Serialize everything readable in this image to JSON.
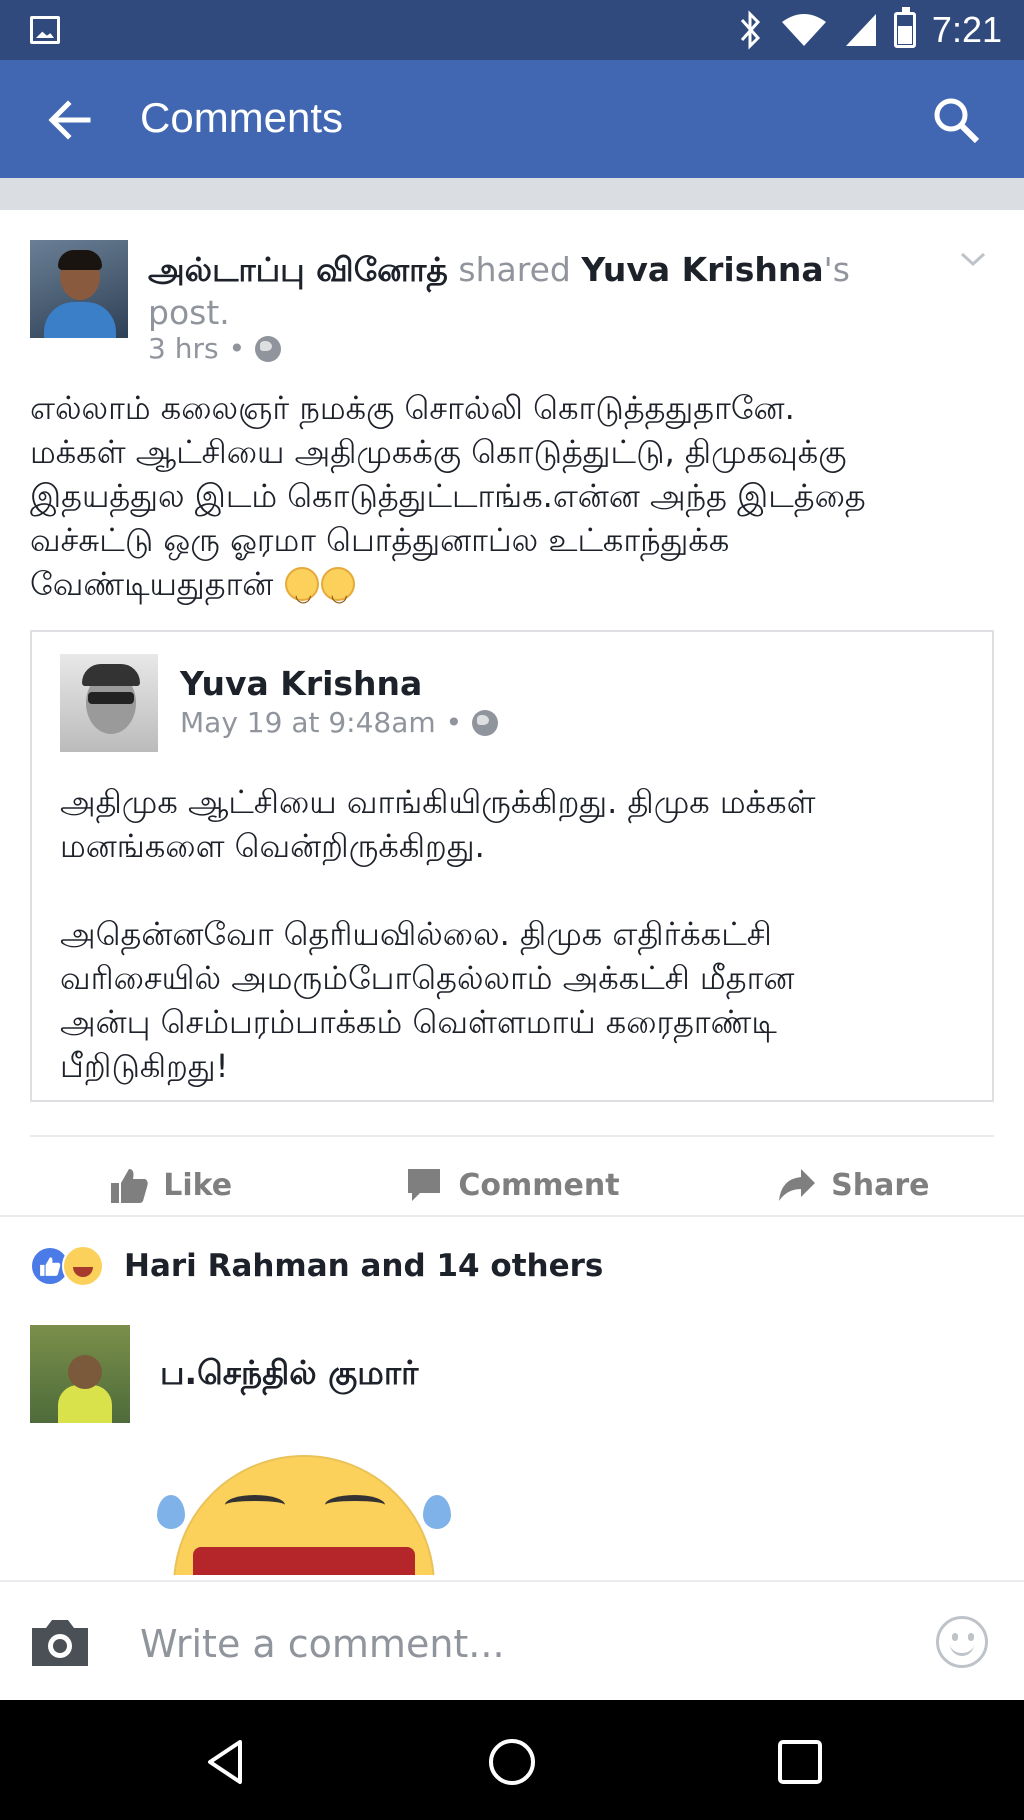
{
  "status_bar": {
    "time": "7:21"
  },
  "app_bar": {
    "title": "Comments"
  },
  "post": {
    "author": "அல்டாப்பு வினோத்",
    "shared_word": "shared",
    "shared_from": "Yuva Krishna",
    "shared_suffix": "'s",
    "post_word": "post.",
    "time": "3 hrs",
    "body": "எல்லாம் கலைஞர் நமக்கு சொல்லி கொடுத்ததுதானே.\nமக்கள் ஆட்சியை அதிமுகக்கு கொடுத்துட்டு, திமுகவுக்கு\nஇதயத்துல இடம் கொடுத்துட்டாங்க.என்ன அந்த இடத்தை\nவச்சுட்டு ஒரு ஓரமா பொத்துனாப்ல உட்காந்துக்க\nவேண்டியதுதான்"
  },
  "shared_post": {
    "name": "Yuva Krishna",
    "time": "May 19 at 9:48am",
    "body": "அதிமுக ஆட்சியை வாங்கியிருக்கிறது. திமுக மக்கள்\nமனங்களை வென்றிருக்கிறது.\n\nஅதென்னவோ தெரியவில்லை. திமுக எதிர்க்கட்சி\nவரிசையில் அமரும்போதெல்லாம் அக்கட்சி மீதான\nஅன்பு செம்பரம்பாக்கம் வெள்ளமாய் கரைதாண்டி\nபீறிடுகிறது!"
  },
  "actions": {
    "like": "Like",
    "comment": "Comment",
    "share": "Share"
  },
  "reactions": {
    "summary": "Hari Rahman and 14 others"
  },
  "comment": {
    "author": "ப.செந்தில் குமார்"
  },
  "composer": {
    "placeholder": "Write a comment..."
  },
  "colors": {
    "app_bar": "#4267b2",
    "status_bar": "#314a7e",
    "secondary_text": "#90949c"
  }
}
